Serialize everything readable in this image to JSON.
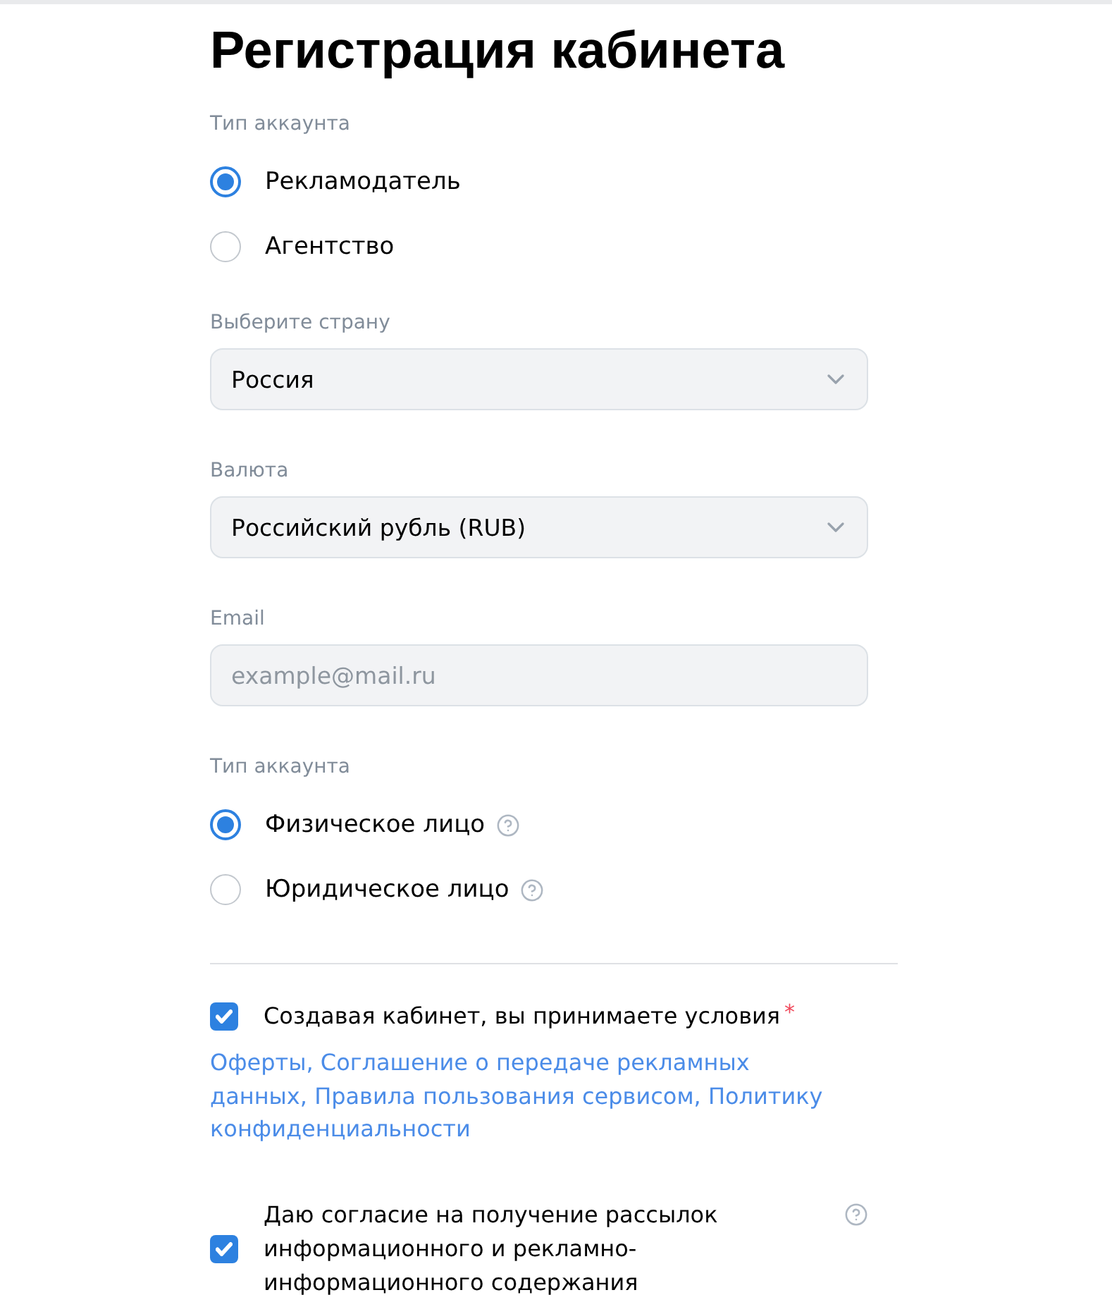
{
  "title": "Регистрация кабинета",
  "account_type": {
    "label": "Тип аккаунта",
    "options": [
      {
        "label": "Рекламодатель",
        "selected": true,
        "help": false
      },
      {
        "label": "Агентство",
        "selected": false,
        "help": false
      }
    ]
  },
  "country": {
    "label": "Выберите страну",
    "value": "Россия"
  },
  "currency": {
    "label": "Валюта",
    "value": "Российский рубль (RUB)"
  },
  "email": {
    "label": "Email",
    "placeholder": "example@mail.ru"
  },
  "legal_type": {
    "label": "Тип аккаунта",
    "options": [
      {
        "label": "Физическое лицо",
        "selected": true,
        "help": true
      },
      {
        "label": "Юридическое лицо",
        "selected": false,
        "help": true
      }
    ]
  },
  "agreements": [
    {
      "text": "Создавая кабинет, вы принимаете условия",
      "checked": true,
      "required_mark": "*",
      "links": "Оферты, Соглашение о передаче рекламных данных, Правила пользования сервисом, Политику конфиденциальности",
      "help": false
    },
    {
      "text": "Даю согласие на получение рассылок информационного и рекламно-информационного содержания",
      "checked": true,
      "help": true
    }
  ]
}
